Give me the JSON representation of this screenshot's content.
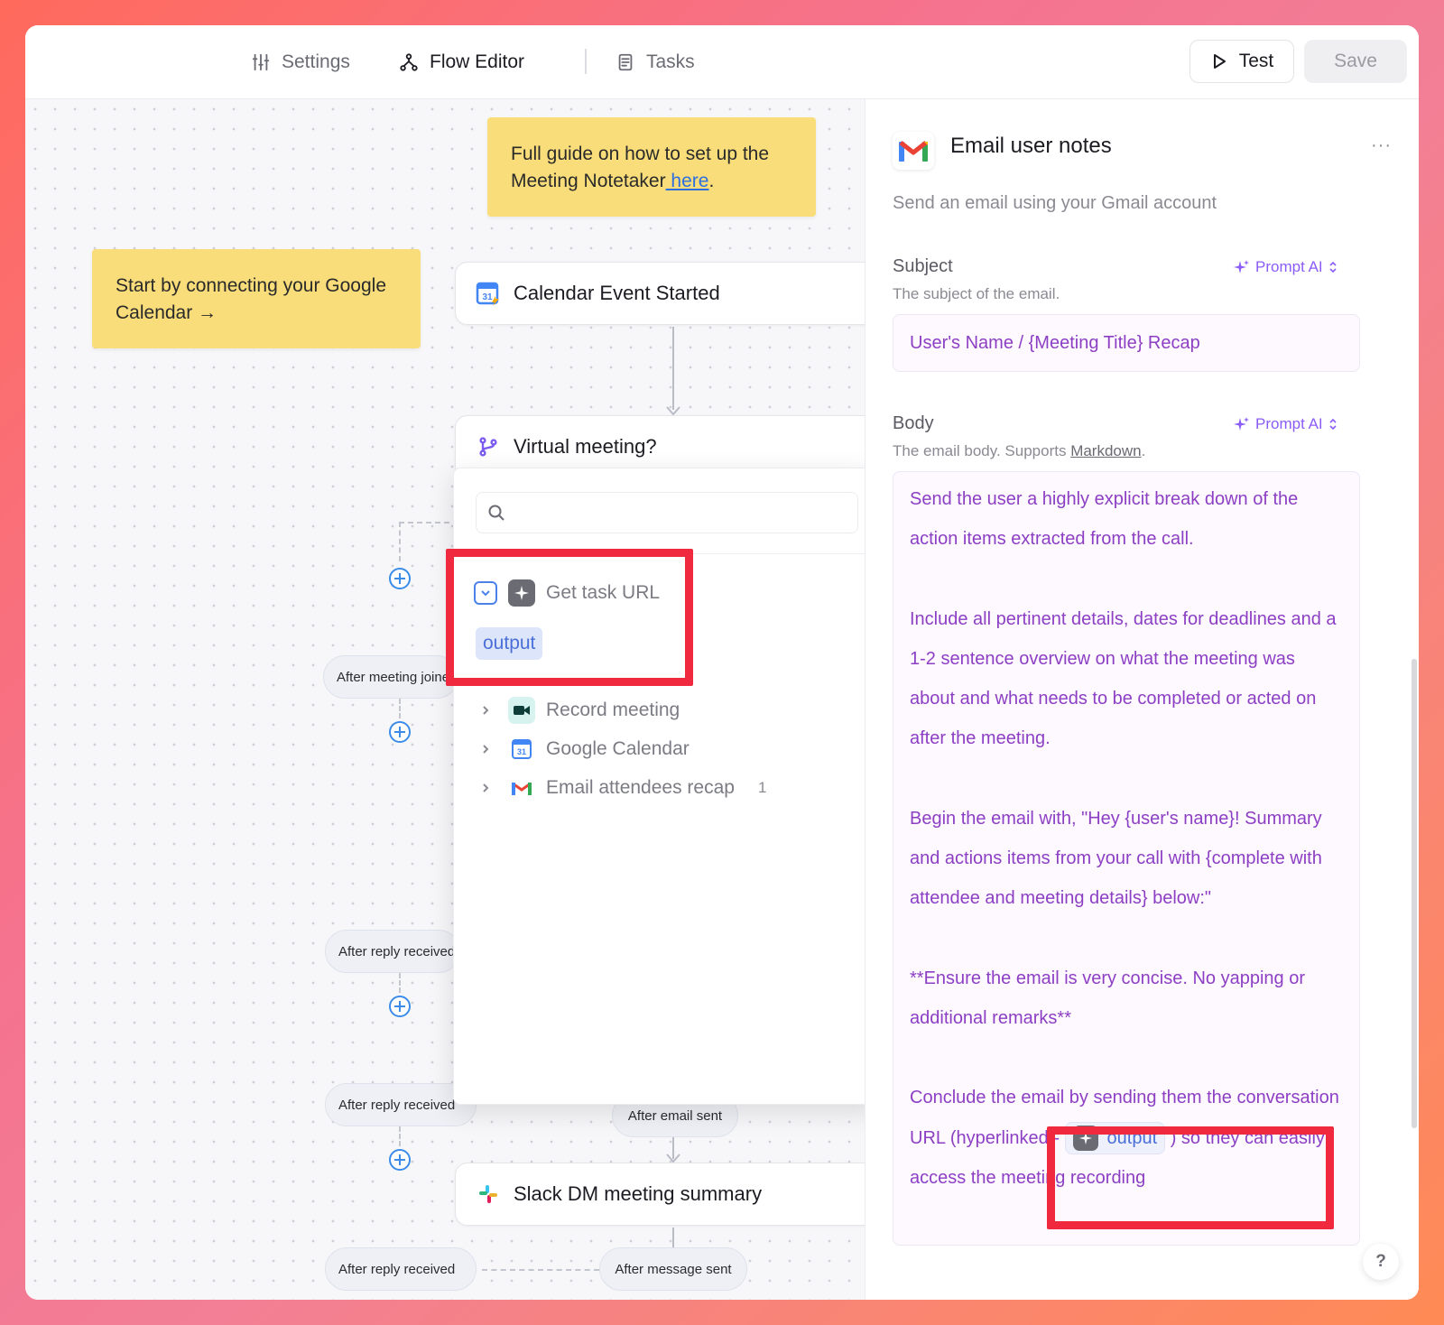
{
  "topbar": {
    "tabs": [
      {
        "label": "Settings",
        "icon": "sliders-icon",
        "active": false
      },
      {
        "label": "Flow Editor",
        "icon": "flow-icon",
        "active": true
      },
      {
        "label": "Tasks",
        "icon": "document-icon",
        "active": false
      }
    ],
    "test_label": "Test",
    "save_label": "Save"
  },
  "canvas": {
    "note_guide_text": "Full guide on how to set up the Meeting Notetaker",
    "note_guide_link": " here",
    "note_guide_tail": ".",
    "note_start": "Start by connecting your Google Calendar →",
    "nodes": {
      "calendar": "Calendar Event Started",
      "virtual": "Virtual meeting?",
      "slack": "Slack DM meeting summary"
    },
    "pills": {
      "after_meeting": "After meeting joined",
      "after_reply_1": "After reply received",
      "after_reply_2": "After reply received",
      "after_email": "After email sent",
      "after_reply_3": "After reply received",
      "after_message": "After message sent"
    }
  },
  "dropdown": {
    "search_placeholder": "",
    "items": [
      {
        "label": "Get task URL",
        "icon": "sparkle-icon",
        "expanded": true,
        "output": "output"
      },
      {
        "label": "Record meeting",
        "icon": "video-icon"
      },
      {
        "label": "Google Calendar",
        "icon": "calendar-icon"
      },
      {
        "label": "Email attendees recap",
        "icon": "gmail-icon",
        "count": "1"
      }
    ]
  },
  "panel": {
    "title": "Email user notes",
    "description": "Send an email using your Gmail account",
    "more": "···",
    "subject": {
      "label": "Subject",
      "sub": "The subject of the email.",
      "prompt_ai": "Prompt AI",
      "value": "User's Name / {Meeting Title} Recap"
    },
    "body": {
      "label": "Body",
      "sub_prefix": "The email body. Supports ",
      "sub_link": "Markdown",
      "sub_suffix": ".",
      "prompt_ai": "Prompt AI",
      "p1": "Send the user a highly explicit break down of the action items extracted from the call.",
      "p2": "Include all pertinent details, dates for deadlines and a 1-2 sentence overview on what the meeting was about and what needs to be completed or acted on after the meeting.",
      "p3": "Begin the email with, \"Hey {user's name}! Summary and actions items from your call with {complete with attendee and meeting details} below:\"",
      "p4": "**Ensure the email is very concise. No yapping or additional remarks**",
      "p5_a": "Conclude the email by sending them the conversation URL (hyperlinked - ",
      "p5_chip": "output",
      "p5_b": ") so they can easily access the meeting recording"
    },
    "help": "?"
  },
  "colors": {
    "accent_purple": "#8d3fc4",
    "highlight_red": "#f0293e",
    "note_yellow": "#f9dd7a",
    "link_blue": "#2d6fe0"
  }
}
